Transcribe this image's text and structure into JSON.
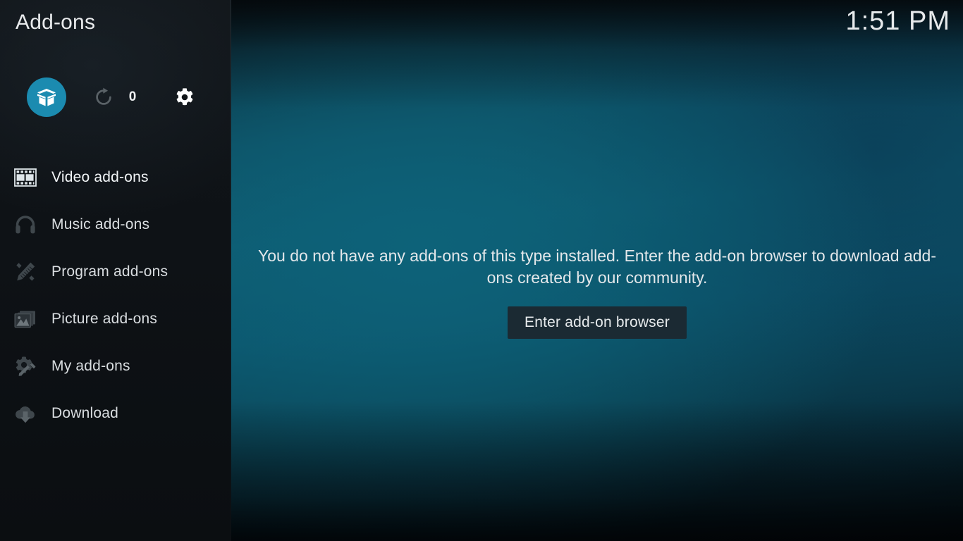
{
  "header": {
    "title": "Add-ons",
    "clock": "1:51 PM"
  },
  "colors": {
    "accent": "#1b8bb0",
    "sidebar_bg": "#0e1216",
    "main_bg_teal": "#0e5a6f",
    "button_bg": "#1b2a33",
    "text_primary": "#e6eaec",
    "icon_muted": "#3b4348"
  },
  "toolbar": {
    "addon_browser": {
      "label": "Add-on browser",
      "icon": "package-box-icon",
      "active": true
    },
    "check_updates": {
      "label": "Check for updates",
      "icon": "refresh-icon",
      "count": "0"
    },
    "settings": {
      "label": "Settings",
      "icon": "gear-icon"
    }
  },
  "sidebar": {
    "items": [
      {
        "label": "Video add-ons",
        "icon": "film-strip-icon",
        "active": true
      },
      {
        "label": "Music add-ons",
        "icon": "headphones-icon",
        "active": false
      },
      {
        "label": "Program add-ons",
        "icon": "pencil-ruler-icon",
        "active": false
      },
      {
        "label": "Picture add-ons",
        "icon": "photo-stack-icon",
        "active": false
      },
      {
        "label": "My add-ons",
        "icon": "gear-screwdriver-icon",
        "active": false
      },
      {
        "label": "Download",
        "icon": "cloud-download-icon",
        "active": false
      }
    ]
  },
  "main": {
    "empty_message": "You do not have any add-ons of this type installed. Enter the add-on browser to download add-ons created by our community.",
    "enter_browser_label": "Enter add-on browser"
  }
}
